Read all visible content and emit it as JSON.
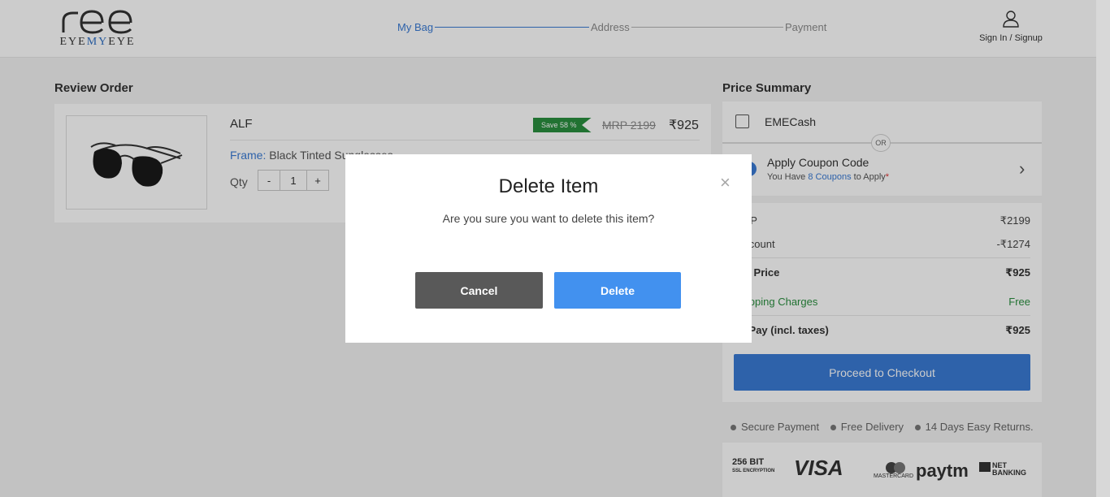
{
  "header": {
    "logo_text_1": "EYE",
    "logo_text_2": "MY",
    "logo_text_3": "EYE",
    "steps": [
      "My Bag",
      "Address",
      "Payment"
    ],
    "signin_label": "Sign In / Signup"
  },
  "review": {
    "title": "Review Order",
    "product_name": "ALF",
    "save_badge": "Save 58 %",
    "mrp": "MRP 2199",
    "price": "₹925",
    "frame_label": "Frame:",
    "frame_value": "Black Tinted Sunglasses",
    "qty_label": "Qty",
    "qty_minus": "-",
    "qty_value": "1",
    "qty_plus": "+"
  },
  "summary": {
    "title": "Price Summary",
    "emecash_label": "EMECash",
    "or_label": "OR",
    "coupon_title": "Apply Coupon Code",
    "coupon_sub_prefix": "You Have",
    "coupon_sub_link": "8 Coupons",
    "coupon_sub_suffix": "to Apply",
    "coupon_star": "*",
    "rows": {
      "mrp_label": "MRP",
      "mrp_value": "₹2199",
      "discount_label": "Discount",
      "discount_value": "-₹1274",
      "net_label": "Net Price",
      "net_value": "₹925",
      "shipping_label": "Shipping Charges",
      "shipping_value": "Free",
      "topay_label": "To Pay (incl. taxes)",
      "topay_value": "₹925"
    },
    "checkout_label": "Proceed to Checkout"
  },
  "trust": [
    "Secure Payment",
    "Free Delivery",
    "14 Days Easy Returns."
  ],
  "payments": {
    "ssl_1": "256 BIT",
    "ssl_2": "SSL ENCRYPTION",
    "visa": "VISA",
    "mastercard": "MASTERCARD",
    "paytm": "paytm",
    "net_1": "NET",
    "net_2": "BANKING"
  },
  "modal": {
    "title": "Delete Item",
    "message": "Are you sure you want to delete this item?",
    "close": "×",
    "cancel_label": "Cancel",
    "delete_label": "Delete"
  },
  "colors": {
    "accent": "#3a7bd5",
    "delete_button": "#4291ef",
    "cancel_button": "#595959",
    "save_badge": "#2a8f3f"
  },
  "icons": [
    "user-icon",
    "coupon-icon",
    "chevron-right-icon",
    "close-icon",
    "sunglasses-image"
  ]
}
